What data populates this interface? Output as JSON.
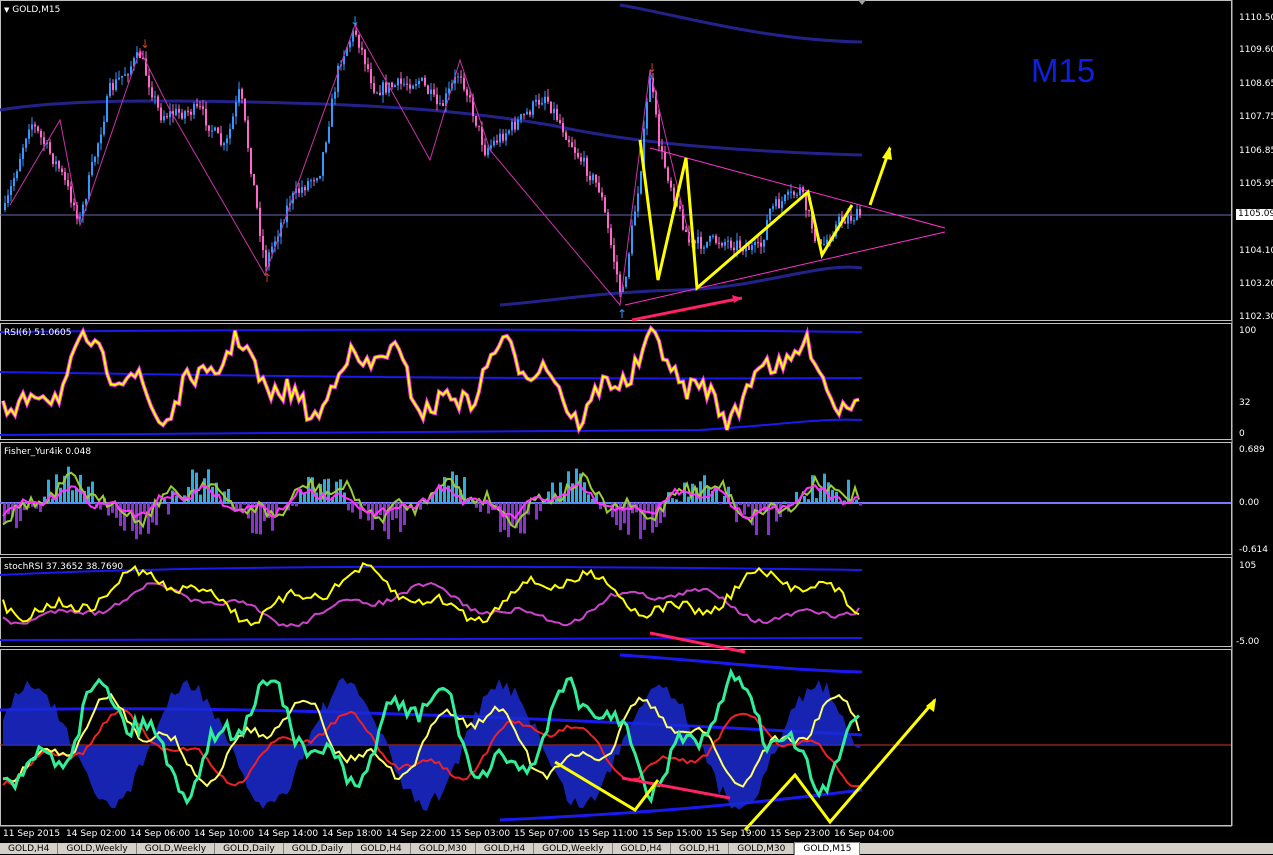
{
  "main_title": "GOLD,M15",
  "timeframe_label": "M15",
  "current_price": "1105.09",
  "price_axis": [
    "1110.50",
    "1109.60",
    "1108.65",
    "1107.75",
    "1106.85",
    "1105.95",
    "1104.10",
    "1103.20",
    "1102.30"
  ],
  "rsi": {
    "title": "RSI(6) 51.0605",
    "axis": [
      "100",
      "32",
      "0"
    ]
  },
  "fisher": {
    "title": "Fisher_Yur4ik 0.048",
    "axis": [
      "0.689",
      "0.00",
      "-0.614"
    ]
  },
  "stoch": {
    "title": "stochRSI 37.3652 38.7690",
    "axis": [
      "105",
      "-5.00"
    ]
  },
  "time_axis": [
    "11 Sep 2015",
    "14 Sep 02:00",
    "14 Sep 06:00",
    "14 Sep 10:00",
    "14 Sep 14:00",
    "14 Sep 18:00",
    "14 Sep 22:00",
    "15 Sep 03:00",
    "15 Sep 07:00",
    "15 Sep 11:00",
    "15 Sep 15:00",
    "15 Sep 19:00",
    "15 Sep 23:00",
    "16 Sep 04:00"
  ],
  "tabs": [
    "GOLD,H4",
    "GOLD,Weekly",
    "GOLD,Weekly",
    "GOLD,Daily",
    "GOLD,Daily",
    "GOLD,H4",
    "GOLD,M30",
    "GOLD,H4",
    "GOLD,Weekly",
    "GOLD,H4",
    "GOLD,H1",
    "GOLD,M30",
    "GOLD,M15"
  ],
  "active_tab": "GOLD,M15",
  "colors": {
    "bull": "#3399ff",
    "bear": "#ff66cc",
    "rsi_line": "#ffff00",
    "fisher_hist": "#33aadd",
    "fisher_neg": "#8833cc",
    "arrow": "#ffff00",
    "trendline": "#ff33cc",
    "band": "#1a1a99"
  }
}
